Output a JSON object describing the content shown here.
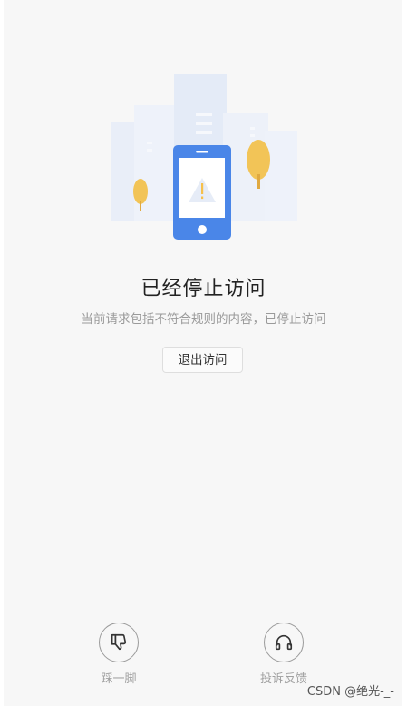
{
  "main": {
    "title": "已经停止访问",
    "subtitle": "当前请求包括不符合规则的内容，已停止访问",
    "exit_button_label": "退出访问"
  },
  "actions": [
    {
      "label": "踩一脚",
      "icon": "thumbs-down-icon"
    },
    {
      "label": "投诉反馈",
      "icon": "headphones-icon"
    }
  ],
  "watermark": "CSDN @绝光-_-",
  "colors": {
    "phone": "#4a86e8",
    "tree": "#f2c457",
    "warning_sign": "#f6c04b",
    "background": "#f7f7f7"
  }
}
